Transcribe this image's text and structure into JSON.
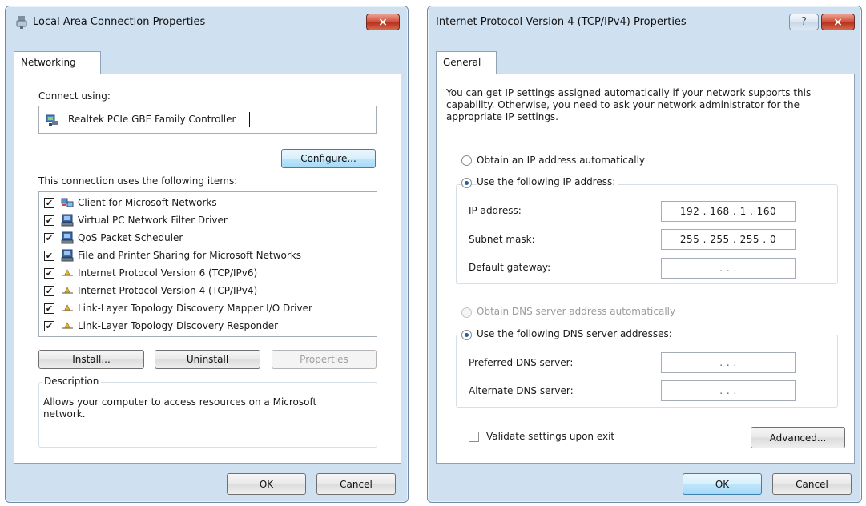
{
  "left": {
    "title": "Local Area Connection Properties",
    "close_glyph": "×",
    "tab": "Networking",
    "connect_using_label": "Connect using:",
    "adapter_name": "Realtek PCIe GBE Family Controller",
    "configure_label": "Configure...",
    "items_label": "This connection uses the following items:",
    "items": [
      {
        "label": "Client for Microsoft Networks",
        "checked": true,
        "icon": "network-client-icon"
      },
      {
        "label": "Virtual PC Network Filter Driver",
        "checked": true,
        "icon": "computer-service-icon"
      },
      {
        "label": "QoS Packet Scheduler",
        "checked": true,
        "icon": "computer-service-icon"
      },
      {
        "label": "File and Printer Sharing for Microsoft Networks",
        "checked": true,
        "icon": "computer-service-icon"
      },
      {
        "label": "Internet Protocol Version 6 (TCP/IPv6)",
        "checked": true,
        "icon": "protocol-icon"
      },
      {
        "label": "Internet Protocol Version 4 (TCP/IPv4)",
        "checked": true,
        "icon": "protocol-icon"
      },
      {
        "label": "Link-Layer Topology Discovery Mapper I/O Driver",
        "checked": true,
        "icon": "protocol-icon"
      },
      {
        "label": "Link-Layer Topology Discovery Responder",
        "checked": true,
        "icon": "protocol-icon"
      }
    ],
    "install_label": "Install...",
    "uninstall_label": "Uninstall",
    "properties_label": "Properties",
    "description_label": "Description",
    "description_text": "Allows your computer to access resources on a Microsoft network.",
    "ok_label": "OK",
    "cancel_label": "Cancel",
    "check_glyph": "✔"
  },
  "right": {
    "title": "Internet Protocol Version 4 (TCP/IPv4) Properties",
    "help_glyph": "?",
    "close_glyph": "×",
    "tab": "General",
    "intro_text": "You can get IP settings assigned automatically if your network supports this capability. Otherwise, you need to ask your network administrator for the appropriate IP settings.",
    "obtain_ip_label": "Obtain an IP address automatically",
    "use_ip_label": "Use the following IP address:",
    "ip_address_label": "IP address:",
    "ip_address_value": "192 . 168 .  1  . 160",
    "subnet_label": "Subnet mask:",
    "subnet_value": "255 . 255 . 255 .  0",
    "gateway_label": "Default gateway:",
    "gateway_value": ".    .    .",
    "obtain_dns_label": "Obtain DNS server address automatically",
    "use_dns_label": "Use the following DNS server addresses:",
    "preferred_dns_label": "Preferred DNS server:",
    "preferred_dns_value": ".    .    .",
    "alternate_dns_label": "Alternate DNS server:",
    "alternate_dns_value": ".    .    .",
    "validate_label": "Validate settings upon exit",
    "validate_checked": false,
    "advanced_label": "Advanced...",
    "ok_label": "OK",
    "cancel_label": "Cancel",
    "ip_mode": "manual",
    "dns_mode": "manual"
  }
}
